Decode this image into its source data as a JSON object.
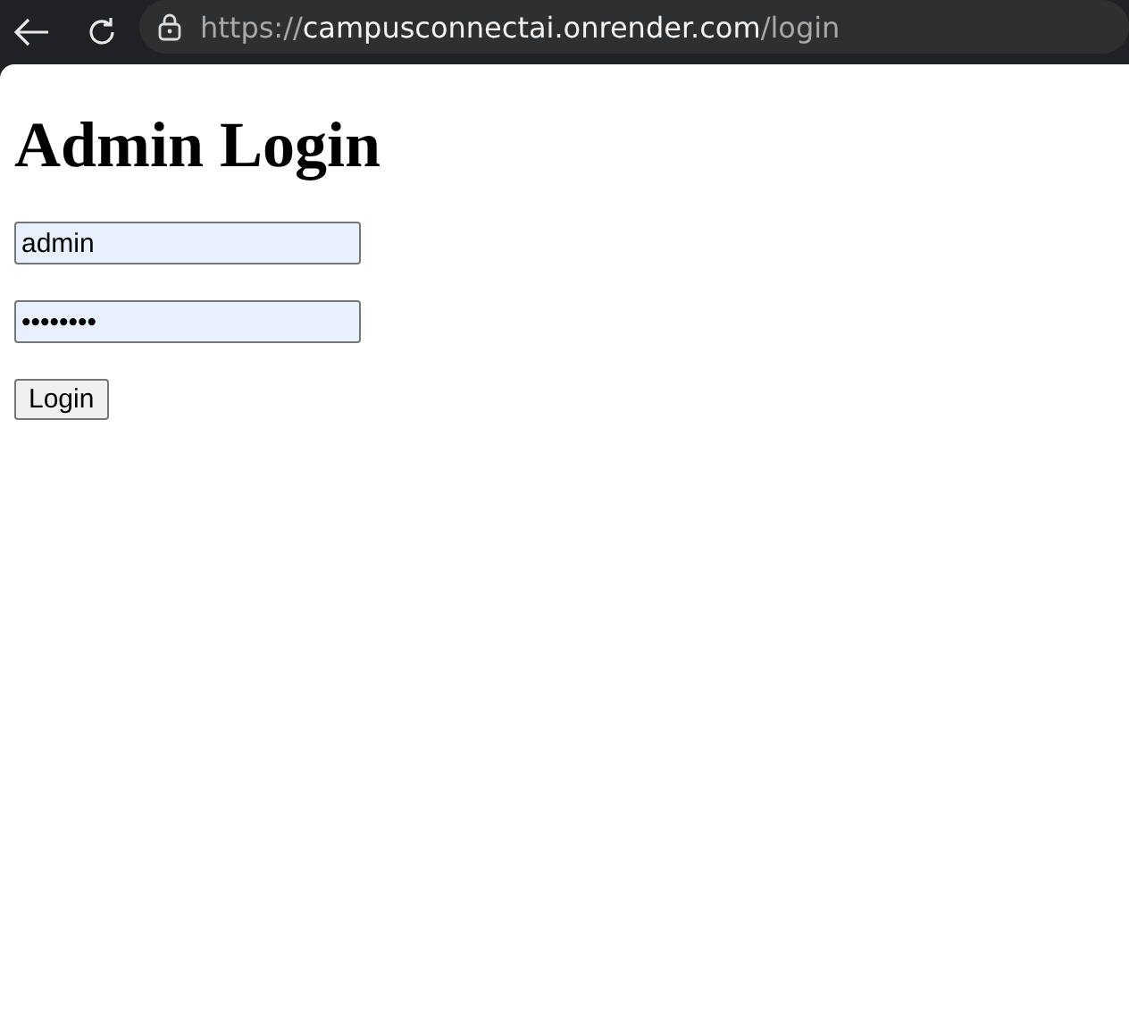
{
  "browser": {
    "url_scheme": "https://",
    "url_host": "campusconnectai.onrender.com",
    "url_path": "/login"
  },
  "page": {
    "title": "Admin Login",
    "username": {
      "value": "admin",
      "autofilled": true
    },
    "password": {
      "value": "••••••••",
      "autofilled": true
    },
    "button": "Login"
  }
}
